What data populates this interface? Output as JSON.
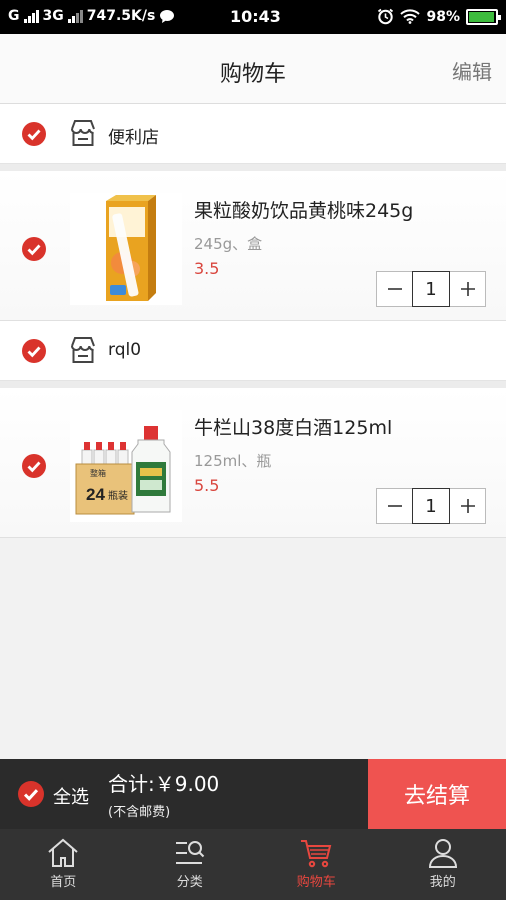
{
  "status_bar": {
    "carrier1": "G",
    "carrier2": "3G",
    "speed": "747.5K/s",
    "time": "10:43",
    "battery": "98%",
    "battery_level": 0.98
  },
  "header": {
    "title": "购物车",
    "edit": "编辑"
  },
  "stores": [
    {
      "name": "便利店",
      "product": {
        "name": "果粒酸奶饮品黄桃味245g",
        "spec": "245g、盒",
        "price": "3.5",
        "qty": "1"
      }
    },
    {
      "name": "rql0",
      "product": {
        "name": "牛栏山38度白酒125ml",
        "spec": "125ml、瓶",
        "price": "5.5",
        "qty": "1"
      }
    }
  ],
  "product_images": {
    "box_label": "24",
    "box_label2": "瓶装",
    "box_top": "整箱"
  },
  "checkout": {
    "select_all": "全选",
    "total": "合计:￥9.00",
    "note": "(不含邮费)",
    "button": "去结算"
  },
  "tabs": [
    {
      "label": "首页",
      "icon": "home-icon"
    },
    {
      "label": "分类",
      "icon": "category-search-icon"
    },
    {
      "label": "购物车",
      "icon": "cart-icon"
    },
    {
      "label": "我的",
      "icon": "user-icon"
    }
  ],
  "colors": {
    "accent": "#ef5350",
    "check": "#d9332b",
    "price": "#d9473f",
    "dark_bar": "#2b2b2b"
  }
}
